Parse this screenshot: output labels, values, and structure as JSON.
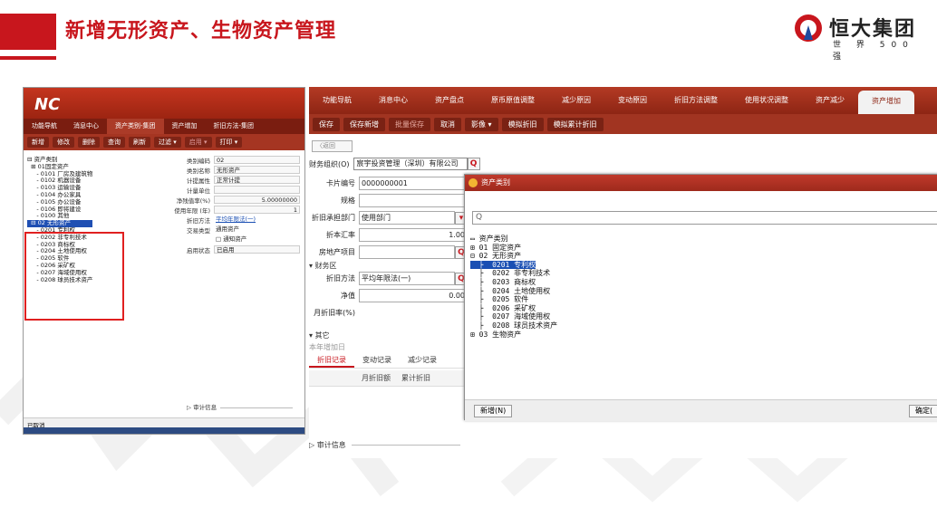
{
  "slide": {
    "title": "新增无形资产、生物资产管理",
    "logo_name": "恒大集团",
    "logo_sub": "世 界 500 强"
  },
  "left": {
    "app_logo": "NC",
    "tabs": [
      "功能导航",
      "消息中心",
      "资产类别-集团",
      "资产增加",
      "折旧方法-集团"
    ],
    "active_tab": 2,
    "toolbar": [
      "新增",
      "修改",
      "删除",
      "查询",
      "刷新",
      "过滤 ▾",
      "启用 ▾",
      "打印 ▾"
    ],
    "tree": [
      "⊟ 资产类别",
      "  ⊞ 01固定资产",
      "     - 0101 厂房及建筑物",
      "     - 0102 机器设备",
      "     - 0103 运输设备",
      "     - 0104 办公家具",
      "     - 0105 办公设备",
      "     - 0106 即将建设",
      "     - 0100 其他",
      "  ⊟ 02 无形资产",
      "     - 0201 专利权",
      "     - 0202 非专利技术",
      "     - 0203 商标权",
      "     - 0204 土地使用权",
      "     - 0205 软件",
      "     - 0206 采矿权",
      "     - 0207 海域使用权",
      "     - 0208 球员技术资产"
    ],
    "form": [
      {
        "label": "类别编码",
        "value": "02"
      },
      {
        "label": "类别名称",
        "value": "无形资产"
      },
      {
        "label": "计提属性",
        "value": "正常计提"
      },
      {
        "label": "计量单位",
        "value": ""
      },
      {
        "label": "净残值率(%)",
        "value": "5.00000000"
      },
      {
        "label": "使用年限 (年)",
        "value": "1"
      },
      {
        "label": "折旧方法",
        "value": "平均年限法(一)"
      },
      {
        "label": "交易类型",
        "value": "通用资产"
      },
      {
        "label": "",
        "value": "□ 通知资产"
      },
      {
        "label": "启用状态",
        "value": "已启用"
      }
    ],
    "audit": "审计信息",
    "status": "已取消"
  },
  "right": {
    "tabs": [
      "功能导航",
      "消息中心",
      "资产盘点",
      "原币原值调整",
      "减少原因",
      "变动原因",
      "折旧方法调整",
      "使用状况调整",
      "资产减少",
      "资产增加"
    ],
    "toolbar": [
      "保存",
      "保存新增",
      "批量保存",
      "取消",
      "影像 ▾",
      "模拟折旧",
      "模拟累计折旧"
    ],
    "back": "〈返回",
    "org_label": "财务组织(O)",
    "org_value": "宸宇投资管理（深圳）有限公司",
    "form": [
      {
        "label": "卡片编号",
        "value": "0000000001"
      },
      {
        "label": "规格",
        "value": ""
      },
      {
        "label": "折旧承担部门",
        "value": "使用部门"
      },
      {
        "label": "折本汇率",
        "value": "1.00"
      },
      {
        "label": "房地产项目",
        "value": ""
      }
    ],
    "finance_section": "财务区",
    "depr_method_label": "折旧方法",
    "depr_method_value": "平均年限法(一)",
    "net_label": "净值",
    "net_value": "0.00",
    "monthly_rate_label": "月折旧率(%)",
    "other_section": "其它",
    "other_cut": "本年增加日",
    "bottom_tabs": [
      "折旧记录",
      "变动记录",
      "减少记录"
    ],
    "grid_headers": [
      "月折旧额",
      "累计折旧"
    ],
    "audit": "审计信息",
    "dialog": {
      "title": "资产类别",
      "search_placeholder": "Q",
      "tree": [
        "资产类别",
        "⊞ 01 固定资产",
        "⊟ 02 无形资产",
        "  0201 专利权",
        "  0202 非专利技术",
        "  0203 商标权",
        "  0204 土地使用权",
        "  0205 软件",
        "  0206 采矿权",
        "  0207 海域使用权",
        "  0208 球员技术资产",
        "⊞ 03 生物资产"
      ],
      "selected_index": 3,
      "new_button": "新增(N)",
      "ok_button": "确定("
    }
  }
}
